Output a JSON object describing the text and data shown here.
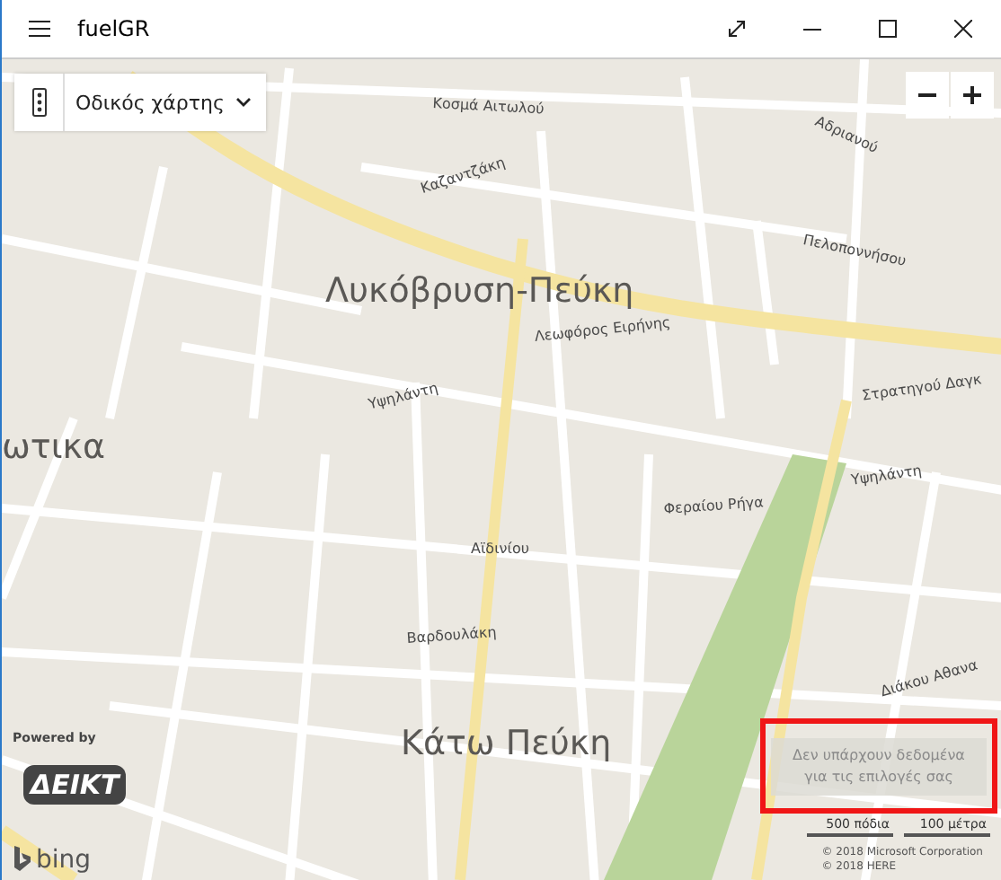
{
  "window": {
    "title": "fuelGR"
  },
  "map_style": {
    "label": "Οδικός χάρτης"
  },
  "map": {
    "labels": [
      {
        "text": "Κοσμά Αιτωλού",
        "kind": "street"
      },
      {
        "text": "Καζαντζάκη",
        "kind": "street"
      },
      {
        "text": "Αδριανού",
        "kind": "street"
      },
      {
        "text": "Πελοποννήσου",
        "kind": "street"
      },
      {
        "text": "Λυκόβρυση-Πεύκη",
        "kind": "area"
      },
      {
        "text": "Λεωφόρος Ειρήνης",
        "kind": "street"
      },
      {
        "text": "ωτικα",
        "kind": "area"
      },
      {
        "text": "Υψηλάντη",
        "kind": "street"
      },
      {
        "text": "Στρατηγού Δαγκ",
        "kind": "street"
      },
      {
        "text": "Υψηλάντη",
        "kind": "street"
      },
      {
        "text": "Φεραίου Ρήγα",
        "kind": "street"
      },
      {
        "text": "Αϊδινίου",
        "kind": "street"
      },
      {
        "text": "Βαρδουλάκη",
        "kind": "street"
      },
      {
        "text": "Διάκου Αθανα",
        "kind": "street"
      },
      {
        "text": "Κάτω Πεύκη",
        "kind": "area"
      }
    ]
  },
  "notice": {
    "message": "Δεν υπάρχουν δεδομένα για τις επιλογές σας",
    "highlighted": true
  },
  "scale": {
    "imperial": "500 πόδια",
    "metric": "100 μέτρα"
  },
  "attribution": [
    "© 2018 Microsoft Corporation",
    "© 2018 HERE"
  ],
  "provider": {
    "caption": "Powered by",
    "logo": "ΔΕΙΚΤ"
  },
  "bing": "bing"
}
